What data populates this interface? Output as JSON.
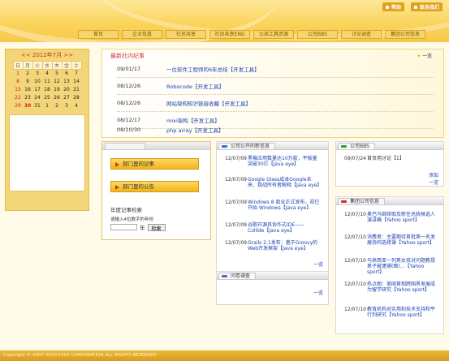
{
  "top_links": [
    "帮助",
    "联系我们"
  ],
  "nav": [
    "首页",
    "企业信息",
    "社员共享",
    "社员共享ENG",
    "公共工具资源",
    "公司BBS",
    "讨论调查",
    "集团公司信息"
  ],
  "calendar": {
    "title": "<< 2012年7月 >>",
    "weekdays": [
      "日",
      "月",
      "火",
      "水",
      "木",
      "金",
      "土"
    ],
    "weeks": [
      [
        "1",
        "2",
        "3",
        "4",
        "5",
        "6",
        "7"
      ],
      [
        "8",
        "9",
        "10",
        "11",
        "12",
        "13",
        "14"
      ],
      [
        "15",
        "16",
        "17",
        "18",
        "19",
        "20",
        "21"
      ],
      [
        "22",
        "23",
        "24",
        "25",
        "26",
        "27",
        "28"
      ],
      [
        "29",
        "30",
        "31",
        "1",
        "2",
        "3",
        "4"
      ]
    ]
  },
  "news": {
    "title": "最新社内纪事",
    "more": "一览",
    "items": [
      {
        "date": "09/01/17",
        "text": "一位软件工程师的6年总结【开发工具】"
      },
      {
        "date": "08/12/26",
        "text": "Robocode【开发工具】"
      },
      {
        "date": "08/12/26",
        "text": "网站架构知识链接收藏【开发工具】"
      },
      {
        "date": "08/12/17",
        "text": "mixi架构【开发工具】"
      },
      {
        "date": "08/10/30",
        "text": "php array【开发工具】"
      }
    ]
  },
  "left_panel": {
    "btn1": "部门里的记事",
    "btn2": "部门里的公告",
    "search_label": "年度记事检索",
    "search_hint": "请输入4位数字的年份",
    "search_suffix": "年",
    "search_button": "检索"
  },
  "company_news": {
    "tab": "公司公开的新信息",
    "items": [
      {
        "date": "12/07/09",
        "text": "黑莓应用数量达10万款，平板量突破30亿【Java eye】"
      },
      {
        "date": "12/07/09",
        "text": "Google Glass成本Google未来，挑战所有者解释【Java eye】"
      },
      {
        "date": "12/07/09",
        "text": "Windows 8 商业正式发布，却已开始 Windows【Java eye】"
      },
      {
        "date": "12/07/09",
        "text": "谷歌开源其协作式IDE——Collide【Java eye】"
      },
      {
        "date": "12/07/09",
        "text": "Grails 2.1发布：基于Groovy的Web开发框架【Java eye】"
      }
    ],
    "more": "一览"
  },
  "survey": {
    "tab": "问卷调查",
    "more": "一览"
  },
  "bbs": {
    "tab": "公司BBS",
    "items": [
      {
        "date": "09/07/24",
        "text": "首页用讨论【1】"
      }
    ],
    "post": "添加",
    "more": "一览"
  },
  "group_news": {
    "tab": "集团公司信息",
    "items": [
      {
        "date": "12/07/10",
        "text": "奥巴马继续取及新任总统候选人演讲稿【Yahoo sport】"
      },
      {
        "date": "12/07/10",
        "text": "消费者：主要期待首批第一名发展协同选修课【Yahoo sport】"
      },
      {
        "date": "12/07/10",
        "text": "马来西亚一列男女孩对问题教授 男子被逮捕(图)…【Yahoo sport】"
      },
      {
        "date": "12/07/10",
        "text": "热点图：美国首相跨国界发展成为留学研究【Yahoo sport】"
      },
      {
        "date": "12/07/10",
        "text": "教育机构对实用和技术支持和平行列研究【Yahoo sport】"
      }
    ]
  },
  "footer": "Copyright © 2007 XXXXXXXX CORPORATION ALL RIGHTS RESERVED"
}
